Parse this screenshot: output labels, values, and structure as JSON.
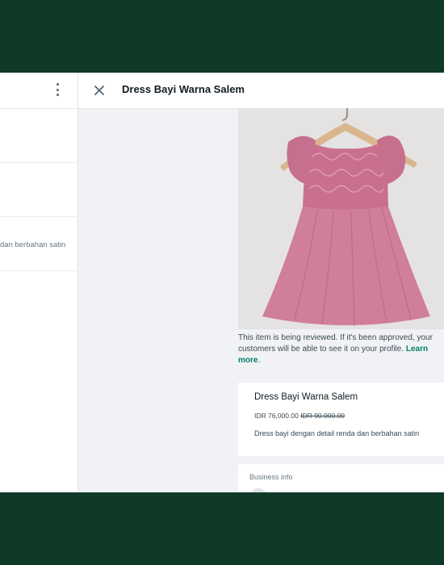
{
  "header": {
    "title": "Dress Bayi Warna Salem"
  },
  "left_pane": {
    "snippet": "dan berbahan satin"
  },
  "product": {
    "review_note": "This item is being reviewed. If it's been approved, your customers will be able to see it on your profile.",
    "learn_more": "Learn more",
    "name": "Dress Bayi Warna Salem",
    "price": "IDR 76,000.00",
    "old_price": "IDR 90.000.00",
    "description": "Dress bayi dengan detail renda dan berbahan satin"
  },
  "business": {
    "label": "Business info"
  },
  "colors": {
    "frame": "#0f3a28",
    "accent": "#008069",
    "dress": "#cf7c98"
  },
  "icons": {
    "close": "close-icon",
    "menu": "kebab-menu-icon"
  }
}
